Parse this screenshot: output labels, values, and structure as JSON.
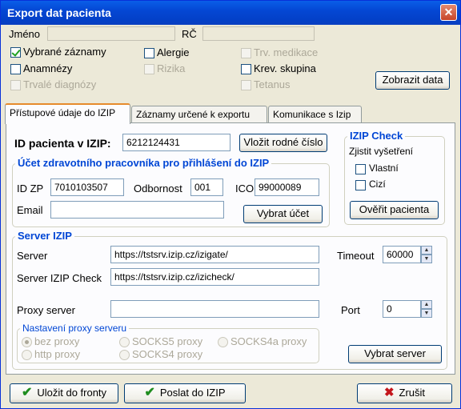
{
  "window": {
    "title": "Export dat pacienta"
  },
  "patient": {
    "name_label": "Jméno",
    "name_value": "",
    "rc_label": "RČ",
    "rc_value": ""
  },
  "options": {
    "vybrane_zaznamy": "Vybrané záznamy",
    "anamnezy": "Anamnézy",
    "trvale_diagnozy": "Trvalé diagnózy",
    "alergie": "Alergie",
    "rizika": "Rizika",
    "trv_medikace": "Trv. medikace",
    "krev_skupina": "Krev. skupina",
    "tetanus": "Tetanus"
  },
  "show_data_label": "Zobrazit data",
  "tabs": [
    {
      "label": "Přístupové údaje do IZIP"
    },
    {
      "label": "Záznamy určené k exportu"
    },
    {
      "label": "Komunikace s Izip"
    }
  ],
  "access": {
    "patient_id_label": "ID pacienta v IZIP:",
    "patient_id_value": "6212124431",
    "insert_rc_button": "Vložit rodné číslo",
    "account_group_title": "Účet zdravotního pracovníka pro přihlášení do IZIP",
    "idzp_label": "ID ZP",
    "idzp_value": "7010103507",
    "odbornost_label": "Odbornost",
    "odbornost_value": "001",
    "ico_label": "ICO",
    "ico_value": "99000089",
    "email_label": "Email",
    "email_value": "",
    "select_account_button": "Vybrat účet"
  },
  "izip_check": {
    "title": "IZIP Check",
    "subtitle": "Zjistit vyšetření",
    "vlastni": "Vlastní",
    "cizi": "Cizí",
    "verify_button": "Ověřit pacienta"
  },
  "server": {
    "group_title": "Server IZIP",
    "server_label": "Server",
    "server_value": "https://tstsrv.izip.cz/izigate/",
    "timeout_label": "Timeout",
    "timeout_value": "60000",
    "check_label": "Server IZIP Check",
    "check_value": "https://tstsrv.izip.cz/izicheck/",
    "proxy_label": "Proxy server",
    "proxy_value": "",
    "port_label": "Port",
    "port_value": "0",
    "proxy_group_title": "Nastavení proxy serveru",
    "proxy_options": {
      "bez": "bez proxy",
      "http": "http proxy",
      "socks5": "SOCKS5 proxy",
      "socks4": "SOCKS4 proxy",
      "socks4a": "SOCKS4a proxy"
    },
    "select_server_button": "Vybrat server"
  },
  "footer": {
    "save_queue": "Uložit do fronty",
    "send_izip": "Poslat do IZIP",
    "cancel": "Zrušit"
  }
}
